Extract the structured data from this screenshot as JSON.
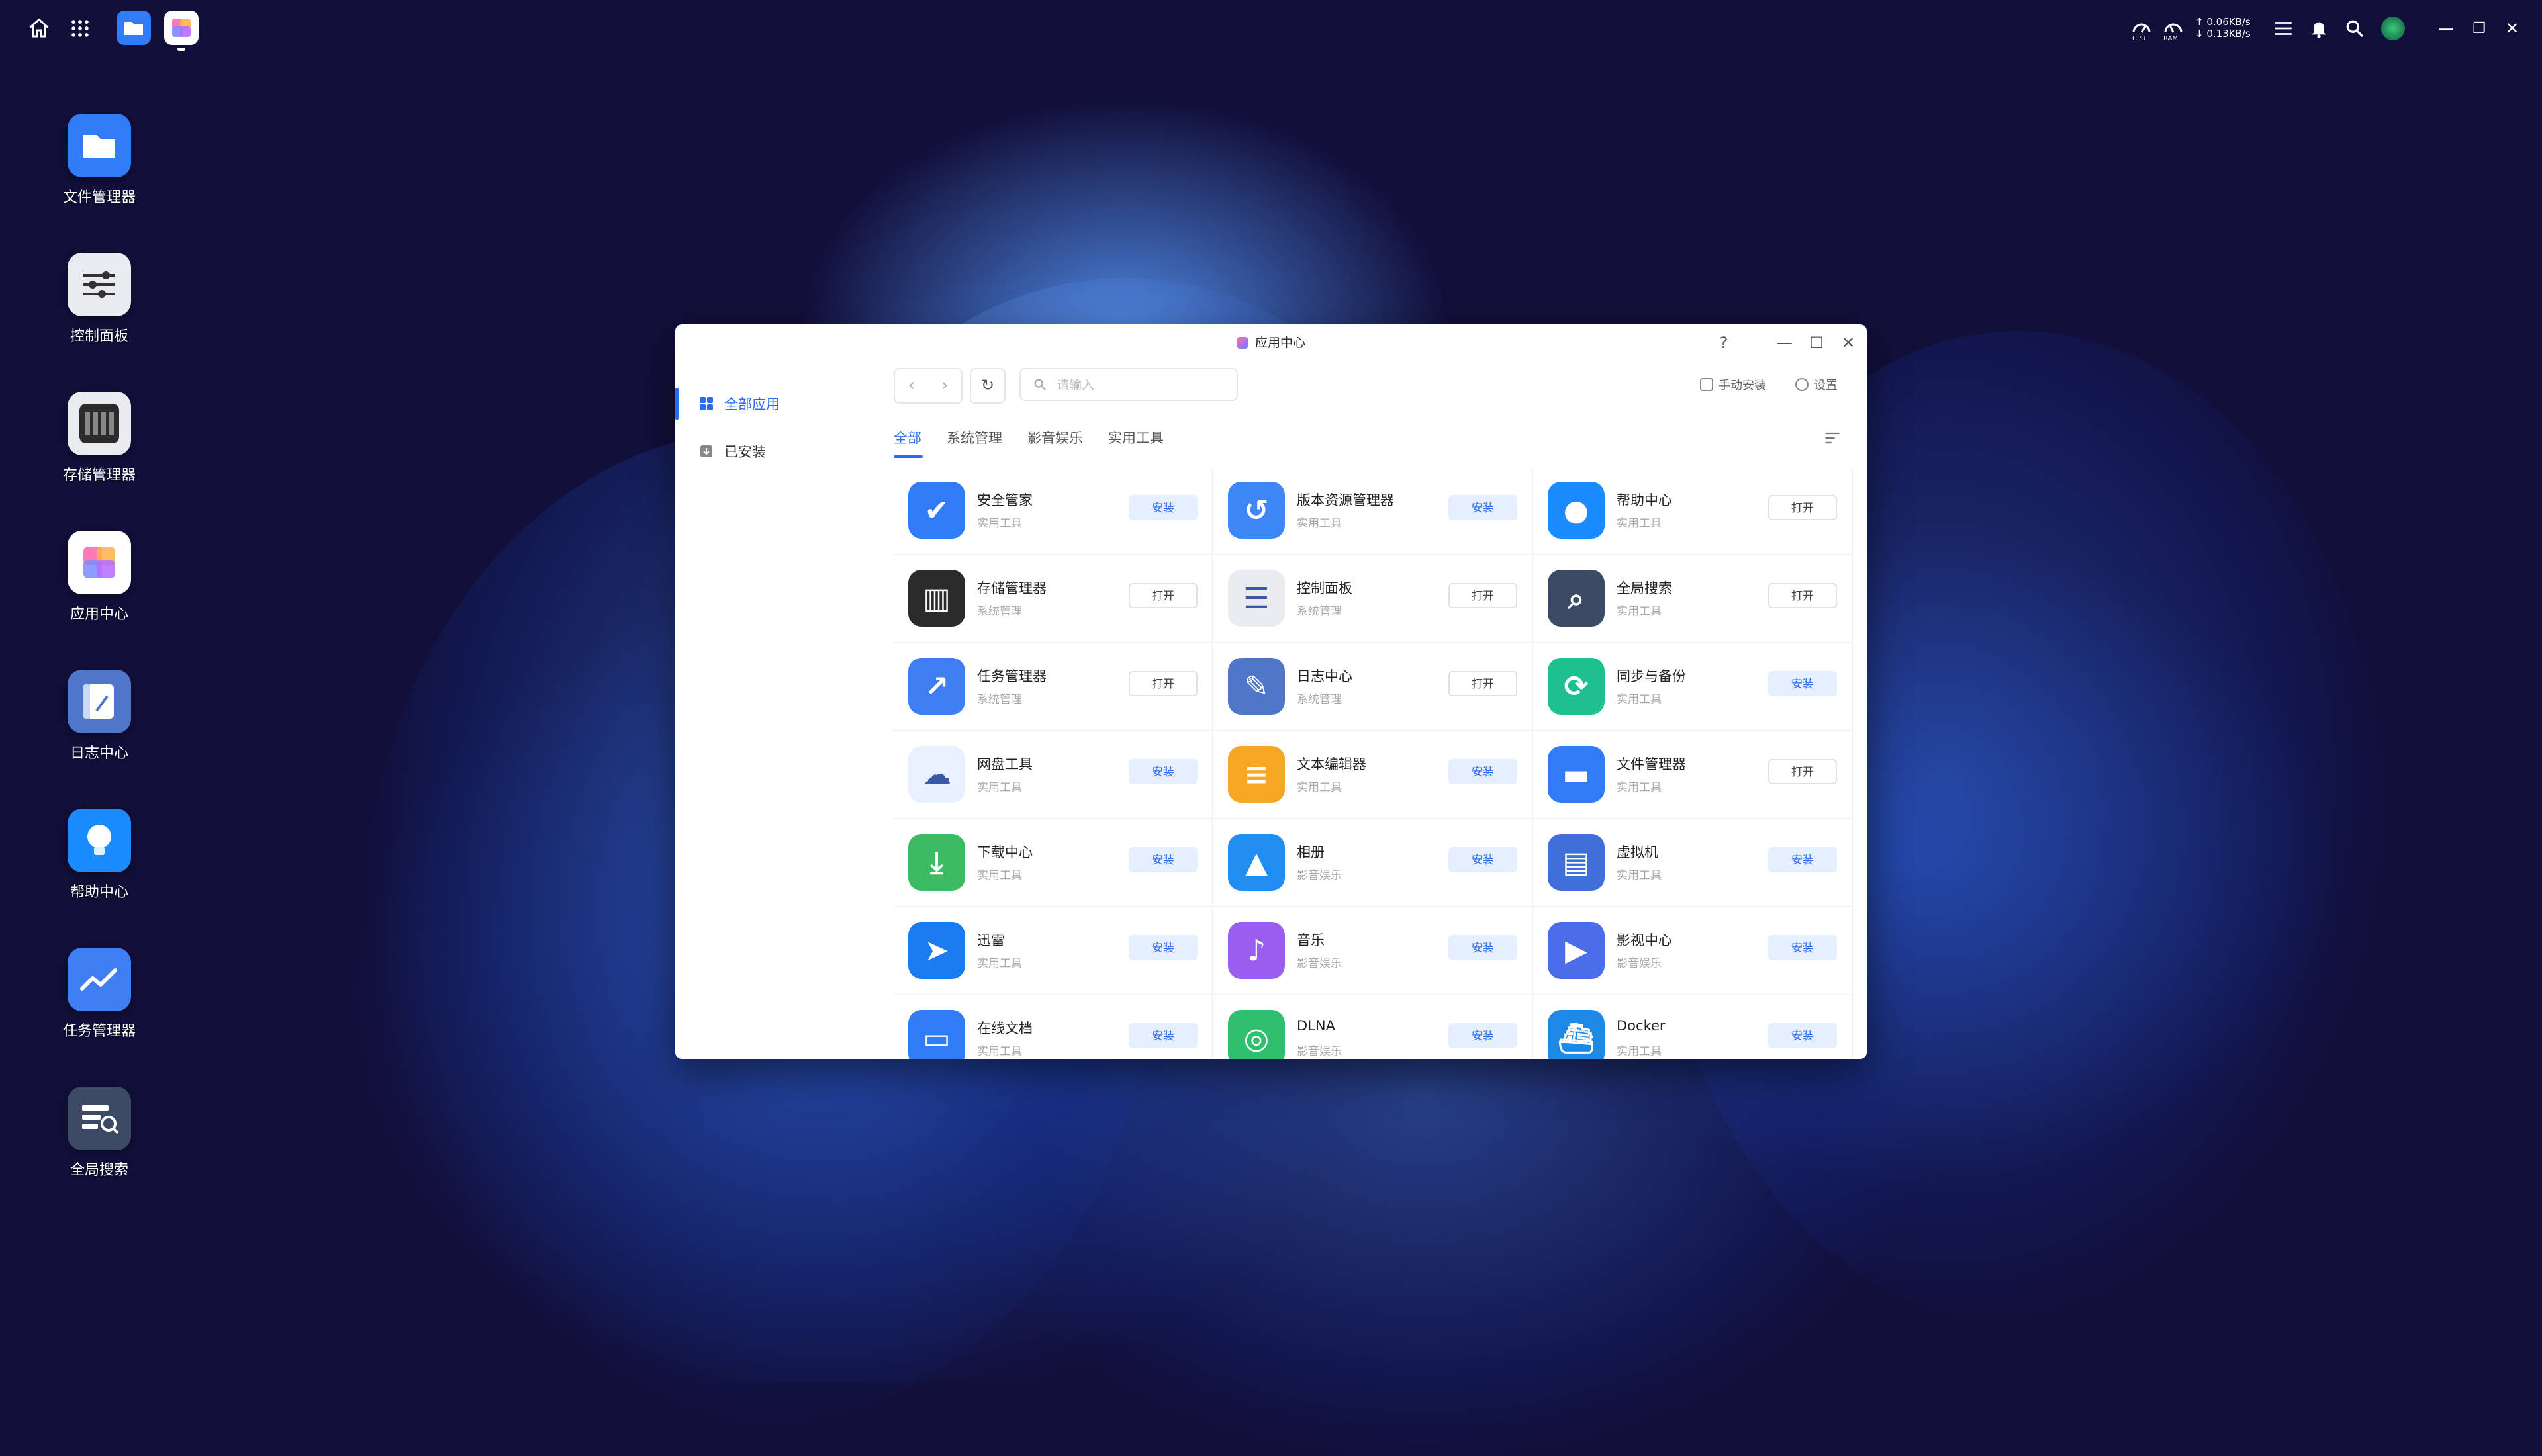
{
  "taskbar": {
    "icons": [
      "home-icon",
      "apps-grid-icon",
      "file-manager-icon",
      "app-center-icon",
      "cpu-icon",
      "ram-icon",
      "panel-icon",
      "bell-icon",
      "search-icon",
      "avatar-icon",
      "minimize-icon",
      "restore-icon",
      "close-icon"
    ],
    "cpu_label": "CPU",
    "ram_label": "RAM",
    "upload_speed": "↑ 0.06KB/s",
    "download_speed": "↓ 0.13KB/s"
  },
  "desktop": {
    "items": [
      {
        "label": "文件管理器",
        "icon": "folder-icon",
        "color": "#2f7cf6"
      },
      {
        "label": "控制面板",
        "icon": "sliders-icon",
        "color": "#e9ebef"
      },
      {
        "label": "存储管理器",
        "icon": "storage-icon",
        "color": "#2b2b2b"
      },
      {
        "label": "应用中心",
        "icon": "app-center-icon",
        "color": "#ffffff"
      },
      {
        "label": "日志中心",
        "icon": "log-icon",
        "color": "#4f76c9"
      },
      {
        "label": "帮助中心",
        "icon": "bulb-icon",
        "color": "#1a8cff"
      },
      {
        "label": "任务管理器",
        "icon": "chart-icon",
        "color": "#3f7ef2"
      },
      {
        "label": "全局搜索",
        "icon": "global-search-icon",
        "color": "#3d4a66"
      }
    ]
  },
  "window": {
    "title": "应用中心",
    "help": "?",
    "minimize": "—",
    "maximize": "☐",
    "close": "✕",
    "sidebar": {
      "items": [
        {
          "label": "全部应用",
          "icon": "grid-icon",
          "active": true
        },
        {
          "label": "已安装",
          "icon": "installed-icon",
          "active": false
        }
      ]
    },
    "toolbar": {
      "back": "‹",
      "forward": "›",
      "refresh": "↻",
      "search_placeholder": "请输入",
      "manual_install": "手动安装",
      "settings": "设置"
    },
    "tabs": [
      {
        "label": "全部",
        "active": true
      },
      {
        "label": "系统管理",
        "active": false
      },
      {
        "label": "影音娱乐",
        "active": false
      },
      {
        "label": "实用工具",
        "active": false
      }
    ],
    "apps": [
      {
        "name": "安全管家",
        "category": "实用工具",
        "action": "安装",
        "installed": false,
        "color": "#2f7cf6",
        "icon": "shield-icon"
      },
      {
        "name": "版本资源管理器",
        "category": "实用工具",
        "action": "安装",
        "installed": false,
        "color": "#3d86f5",
        "icon": "version-icon"
      },
      {
        "name": "帮助中心",
        "category": "实用工具",
        "action": "打开",
        "installed": true,
        "color": "#1a8cff",
        "icon": "bulb-icon"
      },
      {
        "name": "存储管理器",
        "category": "系统管理",
        "action": "打开",
        "installed": true,
        "color": "#2b2b2b",
        "icon": "storage-icon"
      },
      {
        "name": "控制面板",
        "category": "系统管理",
        "action": "打开",
        "installed": true,
        "color": "#e9ebef",
        "icon": "sliders-icon"
      },
      {
        "name": "全局搜索",
        "category": "实用工具",
        "action": "打开",
        "installed": true,
        "color": "#3d4a66",
        "icon": "global-search-icon"
      },
      {
        "name": "任务管理器",
        "category": "系统管理",
        "action": "打开",
        "installed": true,
        "color": "#3f7ef2",
        "icon": "chart-icon"
      },
      {
        "name": "日志中心",
        "category": "系统管理",
        "action": "打开",
        "installed": true,
        "color": "#4f76c9",
        "icon": "log-icon"
      },
      {
        "name": "同步与备份",
        "category": "实用工具",
        "action": "安装",
        "installed": false,
        "color": "#1fbf8f",
        "icon": "sync-icon"
      },
      {
        "name": "网盘工具",
        "category": "实用工具",
        "action": "安装",
        "installed": false,
        "color": "#e9f0ff",
        "icon": "cloud-drive-icon"
      },
      {
        "name": "文本编辑器",
        "category": "实用工具",
        "action": "安装",
        "installed": false,
        "color": "#f5a623",
        "icon": "text-editor-icon"
      },
      {
        "name": "文件管理器",
        "category": "实用工具",
        "action": "打开",
        "installed": true,
        "color": "#2f7cf6",
        "icon": "folder-icon"
      },
      {
        "name": "下载中心",
        "category": "实用工具",
        "action": "安装",
        "installed": false,
        "color": "#3dbb63",
        "icon": "download-icon"
      },
      {
        "name": "相册",
        "category": "影音娱乐",
        "action": "安装",
        "installed": false,
        "color": "#1f8ef0",
        "icon": "photo-icon"
      },
      {
        "name": "虚拟机",
        "category": "实用工具",
        "action": "安装",
        "installed": false,
        "color": "#3f6fd8",
        "icon": "vm-icon"
      },
      {
        "name": "迅雷",
        "category": "实用工具",
        "action": "安装",
        "installed": false,
        "color": "#1a7cf0",
        "icon": "thunder-icon"
      },
      {
        "name": "音乐",
        "category": "影音娱乐",
        "action": "安装",
        "installed": false,
        "color": "#9b5cf0",
        "icon": "music-icon"
      },
      {
        "name": "影视中心",
        "category": "影音娱乐",
        "action": "安装",
        "installed": false,
        "color": "#4a6de8",
        "icon": "video-icon"
      },
      {
        "name": "在线文档",
        "category": "实用工具",
        "action": "安装",
        "installed": false,
        "color": "#2f7cf6",
        "icon": "doc-icon"
      },
      {
        "name": "DLNA",
        "category": "影音娱乐",
        "action": "安装",
        "installed": false,
        "color": "#2fbf6f",
        "icon": "dlna-icon"
      },
      {
        "name": "Docker",
        "category": "实用工具",
        "action": "安装",
        "installed": false,
        "color": "#1e88e5",
        "icon": "docker-icon"
      }
    ]
  }
}
